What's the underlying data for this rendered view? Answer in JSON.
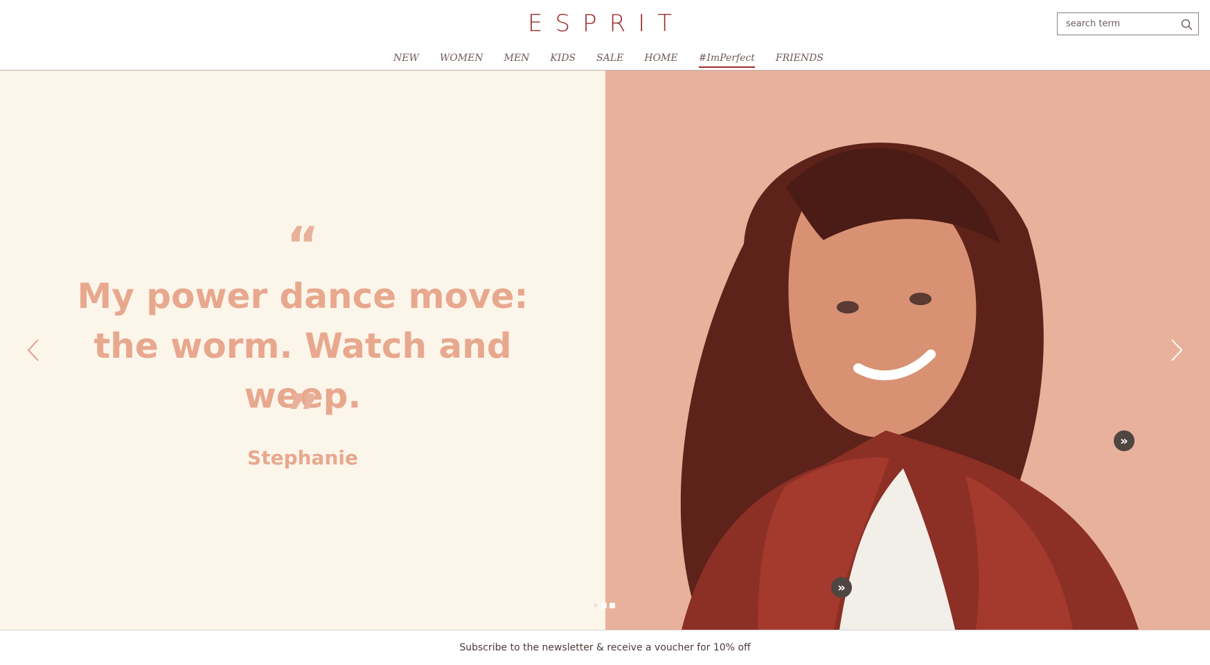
{
  "brand": {
    "logo_text": "ESPRIT",
    "accent_color": "#9a2a2b",
    "hero_left_bg": "#fcf5ea",
    "hero_right_bg": "#e8b19b",
    "quote_color": "#e8a88e"
  },
  "search": {
    "placeholder": "search term",
    "icon": "search-icon"
  },
  "nav": {
    "items": [
      {
        "label": "NEW"
      },
      {
        "label": "WOMEN"
      },
      {
        "label": "MEN"
      },
      {
        "label": "KIDS"
      },
      {
        "label": "SALE"
      },
      {
        "label": "HOME"
      },
      {
        "label": "#ImPerfect",
        "active": true
      },
      {
        "label": "FRIENDS"
      }
    ]
  },
  "hero": {
    "open_quote": "“",
    "quote": "My power dance move: the worm. Watch and weep.",
    "close_quote": "”",
    "author": "Stephanie",
    "left_arrow_icon": "chevron-left-icon",
    "right_arrow_icon": "chevron-right-icon",
    "hotspot_icon": "double-chevron-right-icon",
    "slide_indicator": {
      "current": 1,
      "total": 3
    }
  },
  "newsletter": {
    "text": "Subscribe to the newsletter & receive a voucher for 10% off"
  }
}
